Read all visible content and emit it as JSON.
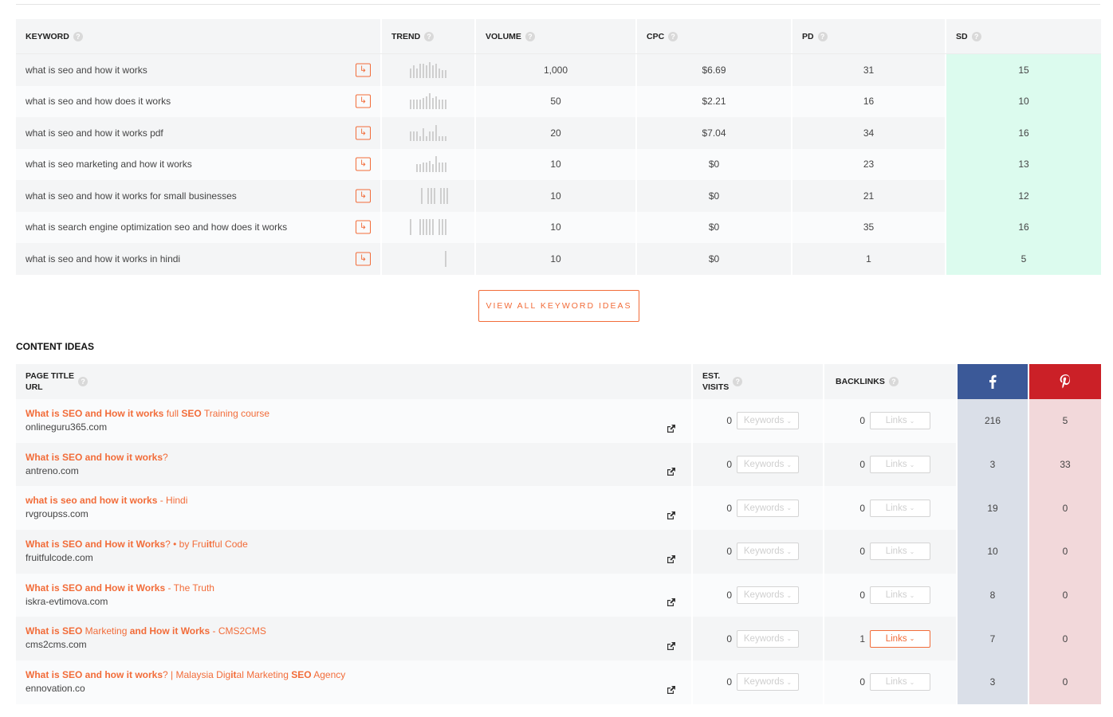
{
  "keywords": {
    "headers": {
      "keyword": "KEYWORD",
      "trend": "TREND",
      "volume": "VOLUME",
      "cpc": "CPC",
      "pd": "PD",
      "sd": "SD"
    },
    "rows": [
      {
        "keyword": "what is seo and how it works",
        "trend": [
          0.6,
          0.8,
          0.6,
          0.9,
          0.9,
          0.8,
          1.0,
          0.8,
          0.9,
          0.6,
          0.5,
          0.5
        ],
        "volume": "1,000",
        "cpc": "$6.69",
        "pd": "31",
        "sd": "15"
      },
      {
        "keyword": "what is seo and how does it works",
        "trend": [
          0.6,
          0.6,
          0.6,
          0.6,
          0.7,
          0.8,
          1.0,
          0.7,
          0.8,
          0.6,
          0.6,
          0.6
        ],
        "volume": "50",
        "cpc": "$2.21",
        "pd": "16",
        "sd": "10"
      },
      {
        "keyword": "what is seo and how it works pdf",
        "trend": [
          0.6,
          0.6,
          0.6,
          0.3,
          0.8,
          0.3,
          0.6,
          0.6,
          1.0,
          0.3,
          0.3,
          0.3
        ],
        "volume": "20",
        "cpc": "$7.04",
        "pd": "34",
        "sd": "16"
      },
      {
        "keyword": "what is seo marketing and how it works",
        "trend": [
          0,
          0,
          0.5,
          0.5,
          0.6,
          0.6,
          0.7,
          0.5,
          1.0,
          0.6,
          0.6,
          0.6
        ],
        "volume": "10",
        "cpc": "$0",
        "pd": "23",
        "sd": "13"
      },
      {
        "keyword": "what is seo and how it works for small businesses",
        "trend": [
          0,
          0,
          0,
          0,
          1,
          0,
          1,
          1,
          1,
          0,
          1,
          1,
          1
        ],
        "volume": "10",
        "cpc": "$0",
        "pd": "21",
        "sd": "12"
      },
      {
        "keyword": "what is search engine optimization seo and how does it works",
        "trend": [
          1,
          0,
          0,
          1,
          1,
          1,
          1,
          1,
          0,
          1,
          1,
          1
        ],
        "volume": "10",
        "cpc": "$0",
        "pd": "35",
        "sd": "16"
      },
      {
        "keyword": "what is seo and how it works in hindi",
        "trend": [
          0,
          0,
          0,
          0,
          0,
          0,
          0,
          0,
          0,
          0,
          0,
          1
        ],
        "volume": "10",
        "cpc": "$0",
        "pd": "1",
        "sd": "5"
      }
    ]
  },
  "view_all_label": "VIEW ALL KEYWORD IDEAS",
  "content_ideas": {
    "section_title": "CONTENT IDEAS",
    "headers": {
      "page_title": "PAGE TITLE",
      "url": "URL",
      "est": "EST.",
      "visits": "VISITS",
      "backlinks": "BACKLINKS"
    },
    "keywords_label": "Keywords",
    "links_label": "Links",
    "rows": [
      {
        "title_parts": [
          {
            "t": "What is SEO and How it works",
            "b": true
          },
          {
            "t": " full ",
            "b": false
          },
          {
            "t": "SEO",
            "b": true
          },
          {
            "t": " Training course",
            "b": false
          }
        ],
        "url": "onlineguru365.com",
        "visits": "0",
        "backlinks": "0",
        "links_active": false,
        "facebook": "216",
        "pinterest": "5"
      },
      {
        "title_parts": [
          {
            "t": "What is SEO and how it works",
            "b": true
          },
          {
            "t": "?",
            "b": false
          }
        ],
        "url": "antreno.com",
        "visits": "0",
        "backlinks": "0",
        "links_active": false,
        "facebook": "3",
        "pinterest": "33"
      },
      {
        "title_parts": [
          {
            "t": "what is seo and how it works",
            "b": true
          },
          {
            "t": " - Hindi",
            "b": false
          }
        ],
        "url": "rvgroupss.com",
        "visits": "0",
        "backlinks": "0",
        "links_active": false,
        "facebook": "19",
        "pinterest": "0"
      },
      {
        "title_parts": [
          {
            "t": "What is SEO and How it Works",
            "b": true
          },
          {
            "t": "? • by Fru",
            "b": false
          },
          {
            "t": "it",
            "b": true
          },
          {
            "t": "ful Code",
            "b": false
          }
        ],
        "url": "fruitfulcode.com",
        "visits": "0",
        "backlinks": "0",
        "links_active": false,
        "facebook": "10",
        "pinterest": "0"
      },
      {
        "title_parts": [
          {
            "t": "What is SEO and How it Works",
            "b": true
          },
          {
            "t": " - The Truth",
            "b": false
          }
        ],
        "url": "iskra-evtimova.com",
        "visits": "0",
        "backlinks": "0",
        "links_active": false,
        "facebook": "8",
        "pinterest": "0"
      },
      {
        "title_parts": [
          {
            "t": "What is SEO",
            "b": true
          },
          {
            "t": " Marketing ",
            "b": false
          },
          {
            "t": "and How it Works",
            "b": true
          },
          {
            "t": " - CMS2CMS",
            "b": false
          }
        ],
        "url": "cms2cms.com",
        "visits": "0",
        "backlinks": "1",
        "links_active": true,
        "facebook": "7",
        "pinterest": "0"
      },
      {
        "title_parts": [
          {
            "t": "What is SEO and how it works",
            "b": true
          },
          {
            "t": "? | Malaysia Dig",
            "b": false
          },
          {
            "t": "it",
            "b": true
          },
          {
            "t": "al Marketing ",
            "b": false
          },
          {
            "t": "SEO",
            "b": true
          },
          {
            "t": " Agency",
            "b": false
          }
        ],
        "url": "ennovation.co",
        "visits": "0",
        "backlinks": "0",
        "links_active": false,
        "facebook": "3",
        "pinterest": "0"
      }
    ]
  },
  "colors": {
    "accent": "#f26c39",
    "sd_bg": "#dcfbee",
    "facebook": "#3b5998",
    "pinterest": "#cb2027"
  },
  "icons": {
    "row_action": "arrow-right-icon",
    "external_link": "external-link-icon",
    "facebook": "facebook-icon",
    "pinterest": "pinterest-icon",
    "help": "question-icon"
  }
}
